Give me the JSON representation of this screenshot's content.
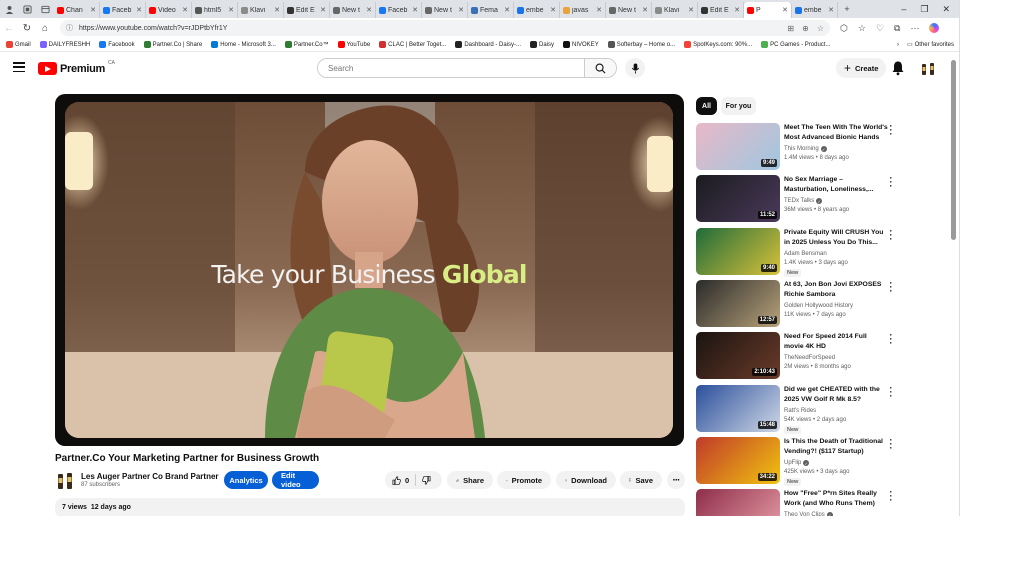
{
  "browser": {
    "tabs": [
      {
        "label": "Chan",
        "color": "#ff0000",
        "active": false
      },
      {
        "label": "Faceb",
        "color": "#1877f2",
        "active": false
      },
      {
        "label": "Video",
        "color": "#ff0000",
        "active": false
      },
      {
        "label": "html5",
        "color": "#555555",
        "active": false
      },
      {
        "label": "Klavi",
        "color": "#8a8a8a",
        "active": false
      },
      {
        "label": "Edit E",
        "color": "#333333",
        "active": false
      },
      {
        "label": "New t",
        "color": "#666666",
        "active": false
      },
      {
        "label": "Faceb",
        "color": "#1877f2",
        "active": false
      },
      {
        "label": "New t",
        "color": "#666666",
        "active": false
      },
      {
        "label": "Fema",
        "color": "#3b6fb6",
        "active": false
      },
      {
        "label": "embe",
        "color": "#1a73e8",
        "active": false
      },
      {
        "label": "javas",
        "color": "#e8a33b",
        "active": false
      },
      {
        "label": "New t",
        "color": "#666666",
        "active": false
      },
      {
        "label": "Klavi",
        "color": "#8a8a8a",
        "active": false
      },
      {
        "label": "Edit E",
        "color": "#333333",
        "active": false
      },
      {
        "label": "P",
        "color": "#ff0000",
        "active": true
      },
      {
        "label": "embe",
        "color": "#1a73e8",
        "active": false
      }
    ],
    "url": "https://www.youtube.com/watch?v=rJDPtbYfr1Y",
    "bookmarks": [
      {
        "label": "Gmail",
        "color": "#ea4335"
      },
      {
        "label": "DAILYFRESHH",
        "color": "#7b61ff"
      },
      {
        "label": "Facebook",
        "color": "#1877f2"
      },
      {
        "label": "Partner.Co | Share",
        "color": "#2e7d32"
      },
      {
        "label": "Home - Microsoft 3...",
        "color": "#0078d4"
      },
      {
        "label": "Partner.Co™",
        "color": "#2e7d32"
      },
      {
        "label": "YouTube",
        "color": "#ff0000"
      },
      {
        "label": "CLAC | Better Toget...",
        "color": "#d32f2f"
      },
      {
        "label": "Dashboard - Daisy-...",
        "color": "#222222"
      },
      {
        "label": "Daisy",
        "color": "#222222"
      },
      {
        "label": "NIVOKEY",
        "color": "#111111"
      },
      {
        "label": "Softerbay – Home o...",
        "color": "#555555"
      },
      {
        "label": "SpotKeys.com: 90%...",
        "color": "#f44336"
      },
      {
        "label": "PC Games - Product...",
        "color": "#4caf50"
      }
    ],
    "other_favorites": "Other favorites"
  },
  "youtube": {
    "logo_word": "Premium",
    "country_code": "CA",
    "search_placeholder": "Search",
    "create_label": "Create",
    "chips": [
      "All",
      "For you"
    ]
  },
  "video": {
    "overlay_text": "Take your Business",
    "overlay_highlight": "Global",
    "title": "Partner.Co Your Marketing Partner for Business Growth",
    "channel_name": "Les Auger Partner Co Brand Partner",
    "subscribers": "87 subscribers",
    "analytics_label": "Analytics",
    "edit_label": "Edit video",
    "like_count": "0",
    "share_label": "Share",
    "promote_label": "Promote",
    "download_label": "Download",
    "save_label": "Save",
    "views": "7 views",
    "age": "12 days ago"
  },
  "recommendations": [
    {
      "title": "Meet The Teen With The World's Most Advanced Bionic Hands |...",
      "channel": "This Morning",
      "verified": true,
      "views": "1.4M views",
      "age": "8 days ago",
      "duration": "9:49",
      "is_new": false,
      "thumb": "linear-gradient(135deg,#e9b8c7,#9ec7e0)"
    },
    {
      "title": "No Sex Marriage – Masturbation, Loneliness,...",
      "channel": "TEDx Talks",
      "verified": true,
      "views": "36M views",
      "age": "8 years ago",
      "duration": "11:52",
      "is_new": false,
      "thumb": "linear-gradient(135deg,#1b1b1f,#4a3a5a)"
    },
    {
      "title": "Private Equity Will CRUSH You in 2025 Unless You Do This...",
      "channel": "Adam Bensman",
      "verified": false,
      "views": "1.4K views",
      "age": "3 days ago",
      "duration": "9:40",
      "is_new": true,
      "thumb": "linear-gradient(135deg,#1f6b3a,#d9c23a)"
    },
    {
      "title": "At 63, Jon Bon Jovi EXPOSES Richie Sambora",
      "channel": "Golden Hollywood History",
      "verified": false,
      "views": "11K views",
      "age": "7 days ago",
      "duration": "12:57",
      "is_new": false,
      "thumb": "linear-gradient(135deg,#2a2a2a,#b8a27a)"
    },
    {
      "title": "Need For Speed 2014 Full movie 4K HD",
      "channel": "TheNeedForSpeed",
      "verified": false,
      "views": "2M views",
      "age": "8 months ago",
      "duration": "2:10:43",
      "is_new": false,
      "thumb": "linear-gradient(135deg,#1a1410,#6b3b2a)"
    },
    {
      "title": "Did we get CHEATED with the 2025 VW Golf R Mk 8.5?",
      "channel": "Ratt's Rides",
      "verified": false,
      "views": "54K views",
      "age": "2 days ago",
      "duration": "15:48",
      "is_new": true,
      "thumb": "linear-gradient(135deg,#2b4f9c,#cfd8e6)"
    },
    {
      "title": "Is This the Death of Traditional Vending?! ($117 Startup)",
      "channel": "UpFlip",
      "verified": true,
      "views": "425K views",
      "age": "3 days ago",
      "duration": "34:22",
      "is_new": true,
      "thumb": "linear-gradient(135deg,#c0392b,#f1c40f)"
    },
    {
      "title": "How \"Free\" P*rn Sites Really Work (and Who Runs Them)",
      "channel": "Theo Von Clips",
      "verified": true,
      "views": "",
      "age": "",
      "duration": "",
      "is_new": false,
      "thumb": "linear-gradient(135deg,#8e2d4a,#e8a0a8)"
    }
  ]
}
